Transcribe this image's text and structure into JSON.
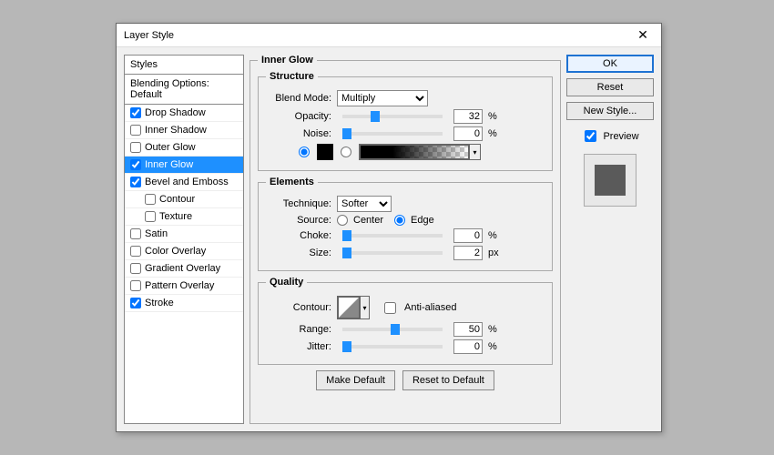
{
  "title": "Layer Style",
  "sidebar": {
    "header": "Styles",
    "blending": "Blending Options: Default",
    "items": [
      {
        "label": "Drop Shadow",
        "checked": true,
        "indent": false
      },
      {
        "label": "Inner Shadow",
        "checked": false,
        "indent": false
      },
      {
        "label": "Outer Glow",
        "checked": false,
        "indent": false
      },
      {
        "label": "Inner Glow",
        "checked": true,
        "indent": false,
        "selected": true
      },
      {
        "label": "Bevel and Emboss",
        "checked": true,
        "indent": false
      },
      {
        "label": "Contour",
        "checked": false,
        "indent": true
      },
      {
        "label": "Texture",
        "checked": false,
        "indent": true
      },
      {
        "label": "Satin",
        "checked": false,
        "indent": false
      },
      {
        "label": "Color Overlay",
        "checked": false,
        "indent": false
      },
      {
        "label": "Gradient Overlay",
        "checked": false,
        "indent": false
      },
      {
        "label": "Pattern Overlay",
        "checked": false,
        "indent": false
      },
      {
        "label": "Stroke",
        "checked": true,
        "indent": false
      }
    ]
  },
  "panel": {
    "title": "Inner Glow",
    "structure": {
      "legend": "Structure",
      "blend_mode_label": "Blend Mode:",
      "blend_mode_value": "Multiply",
      "opacity_label": "Opacity:",
      "opacity_value": "32",
      "opacity_unit": "%",
      "noise_label": "Noise:",
      "noise_value": "0",
      "noise_unit": "%"
    },
    "elements": {
      "legend": "Elements",
      "technique_label": "Technique:",
      "technique_value": "Softer",
      "source_label": "Source:",
      "source_center": "Center",
      "source_edge": "Edge",
      "choke_label": "Choke:",
      "choke_value": "0",
      "choke_unit": "%",
      "size_label": "Size:",
      "size_value": "2",
      "size_unit": "px"
    },
    "quality": {
      "legend": "Quality",
      "contour_label": "Contour:",
      "antialiased_label": "Anti-aliased",
      "range_label": "Range:",
      "range_value": "50",
      "range_unit": "%",
      "jitter_label": "Jitter:",
      "jitter_value": "0",
      "jitter_unit": "%"
    },
    "make_default": "Make Default",
    "reset_default": "Reset to Default"
  },
  "side": {
    "ok": "OK",
    "reset": "Reset",
    "new_style": "New Style...",
    "preview": "Preview"
  }
}
